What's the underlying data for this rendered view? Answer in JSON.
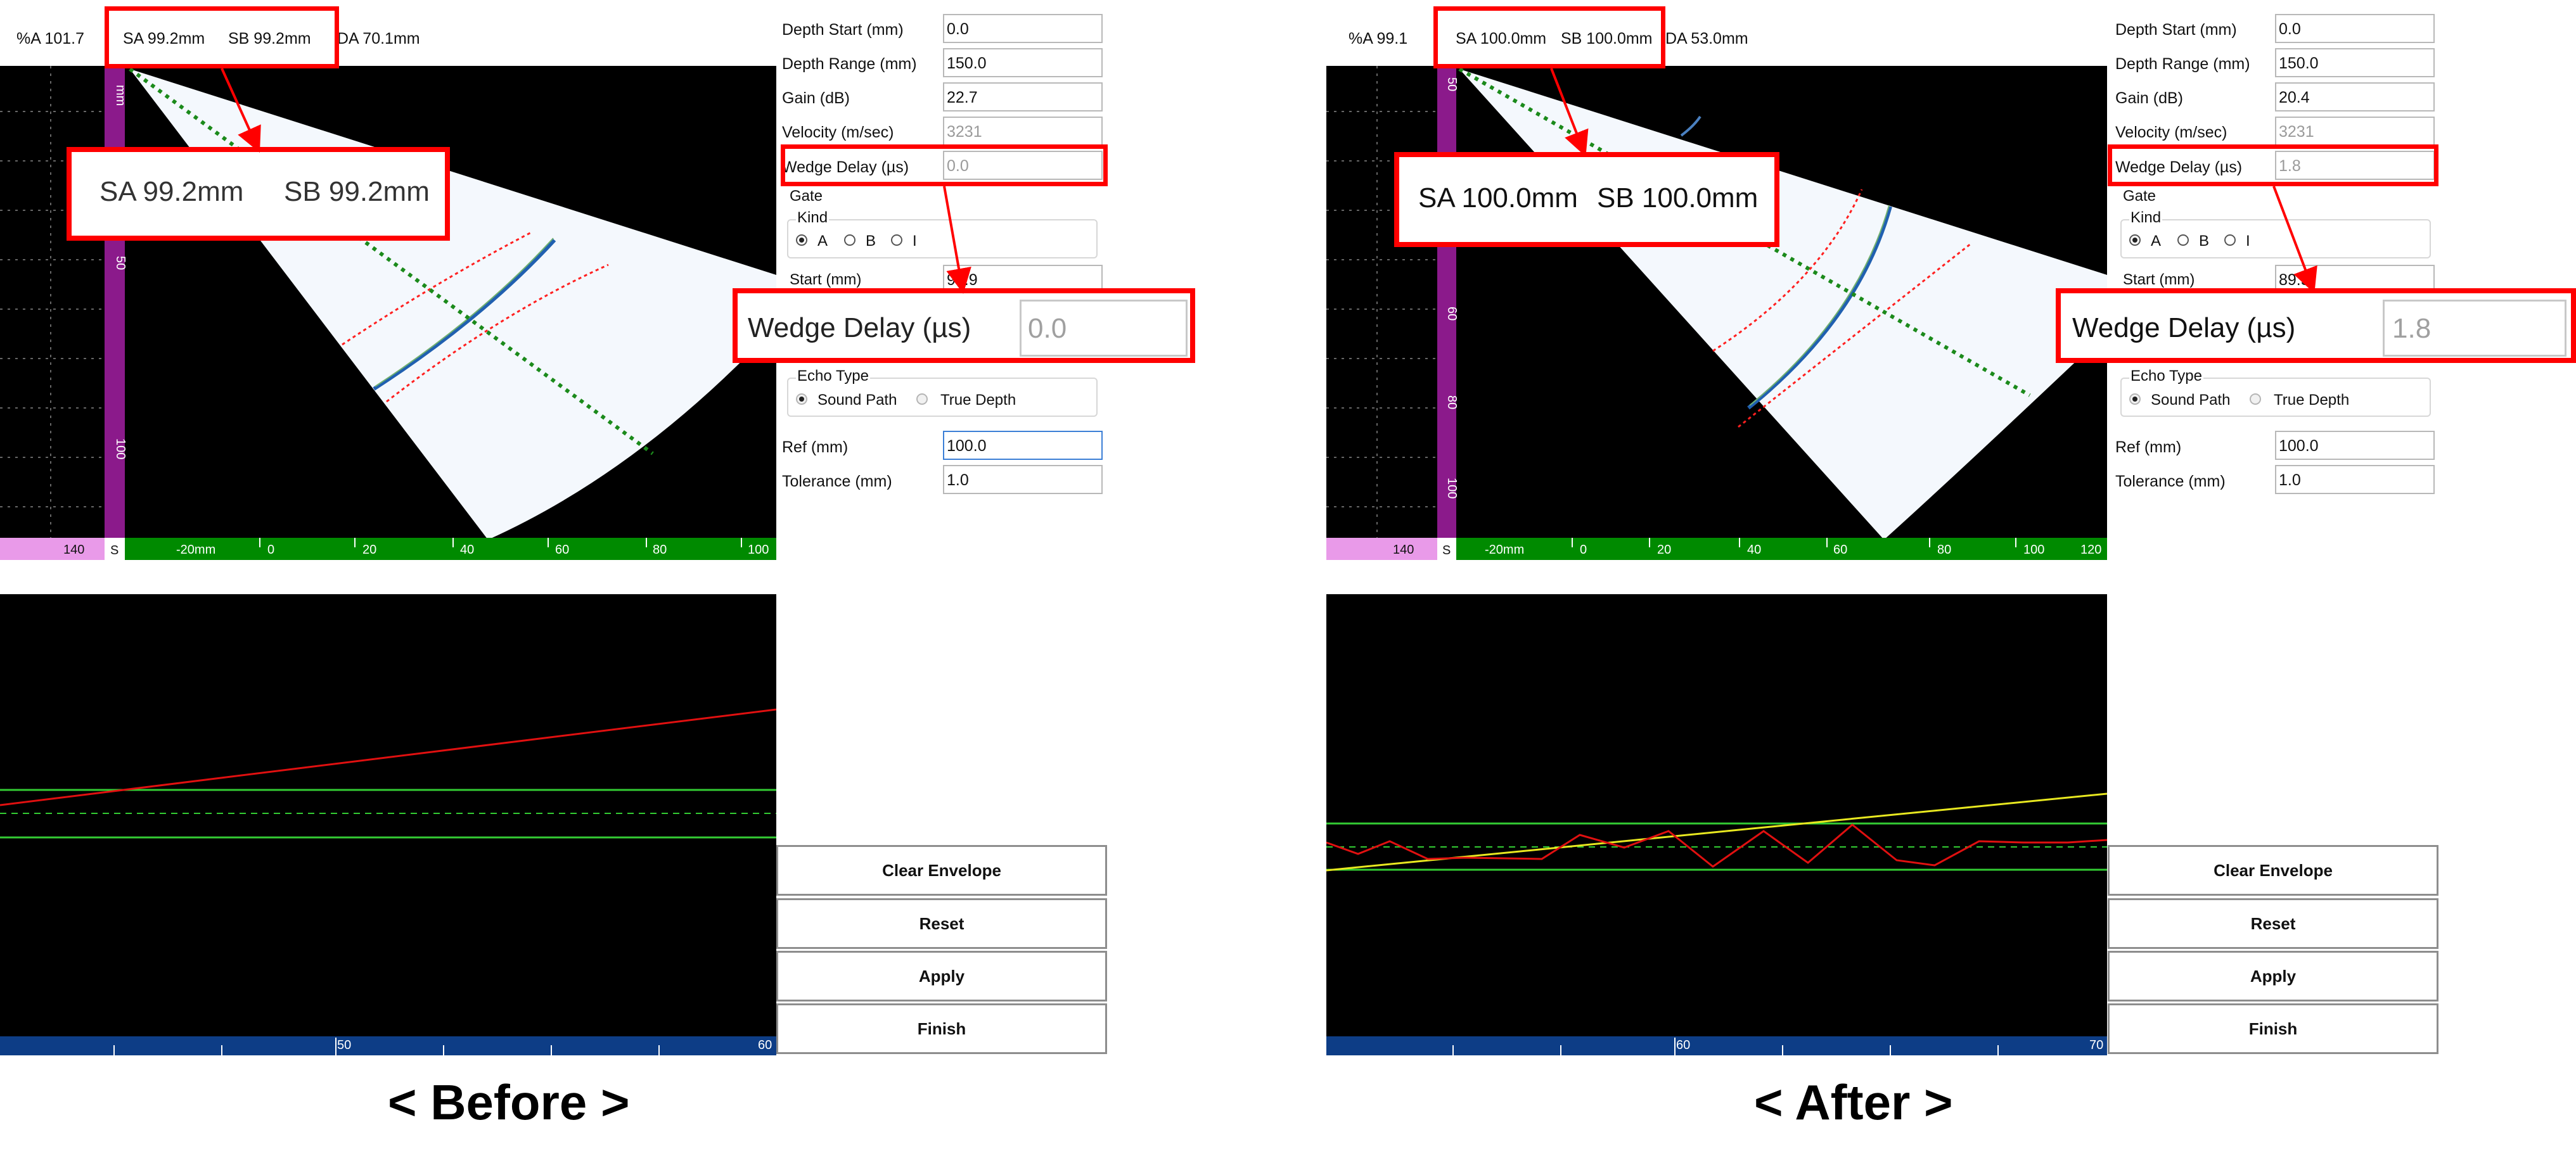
{
  "captions": {
    "before": "< Before >",
    "after": "< After >"
  },
  "before": {
    "top": {
      "pa": "%A 101.7",
      "sa": "SA 99.2mm",
      "sb": "SB 99.2mm",
      "da": "DA 70.1mm"
    },
    "zoom_sa": "SA 99.2mm",
    "zoom_sb": "SB 99.2mm",
    "zoom_wedge_label": "Wedge Delay (µs)",
    "zoom_wedge_value": "0.0",
    "params": {
      "depth_start_label": "Depth Start (mm)",
      "depth_start": "0.0",
      "depth_range_label": "Depth Range (mm)",
      "depth_range": "150.0",
      "gain_label": "Gain (dB)",
      "gain": "22.7",
      "velocity_label": "Velocity (m/sec)",
      "velocity": "3231",
      "wedge_label": "Wedge Delay (µs)",
      "wedge": "0.0",
      "gate_label": "Gate",
      "kind_label": "Kind",
      "kind_a": "A",
      "kind_b": "B",
      "kind_i": "I",
      "start_label": "Start (mm)",
      "start": "90.9",
      "echo_label": "Echo Type",
      "sound_path": "Sound Path",
      "true_depth": "True Depth",
      "ref_label": "Ref (mm)",
      "ref": "100.0",
      "tol_label": "Tolerance (mm)",
      "tol": "1.0"
    },
    "scan": {
      "vticks": [
        "mm",
        "50",
        "100"
      ],
      "hticks": [
        "140",
        "S",
        "-20mm",
        "0",
        "20",
        "40",
        "60",
        "80",
        "100"
      ]
    },
    "ascan": {
      "ticks": [
        "50",
        "60"
      ]
    },
    "buttons": {
      "clear": "Clear Envelope",
      "reset": "Reset",
      "apply": "Apply",
      "finish": "Finish"
    }
  },
  "after": {
    "top": {
      "pa": "%A 99.1",
      "sa": "SA 100.0mm",
      "sb": "SB 100.0mm",
      "da": "DA 53.0mm"
    },
    "zoom_sa": "SA 100.0mm",
    "zoom_sb": "SB 100.0mm",
    "zoom_wedge_label": "Wedge Delay (µs)",
    "zoom_wedge_value": "1.8",
    "params": {
      "depth_start_label": "Depth Start (mm)",
      "depth_start": "0.0",
      "depth_range_label": "Depth Range (mm)",
      "depth_range": "150.0",
      "gain_label": "Gain (dB)",
      "gain": "20.4",
      "velocity_label": "Velocity (m/sec)",
      "velocity": "3231",
      "wedge_label": "Wedge Delay (µs)",
      "wedge": "1.8",
      "gate_label": "Gate",
      "kind_label": "Kind",
      "kind_a": "A",
      "kind_b": "B",
      "kind_i": "I",
      "start_label": "Start (mm)",
      "start": "89.5",
      "echo_label": "Echo Type",
      "sound_path": "Sound Path",
      "true_depth": "True Depth",
      "ref_label": "Ref (mm)",
      "ref": "100.0",
      "tol_label": "Tolerance (mm)",
      "tol": "1.0"
    },
    "scan": {
      "vticks": [
        "50",
        "60",
        "80",
        "100"
      ],
      "hticks": [
        "140",
        "S",
        "-20mm",
        "0",
        "20",
        "40",
        "60",
        "80",
        "100",
        "120"
      ]
    },
    "ascan": {
      "ticks": [
        "60",
        "70"
      ]
    },
    "buttons": {
      "clear": "Clear Envelope",
      "reset": "Reset",
      "apply": "Apply",
      "finish": "Finish"
    }
  },
  "colors": {
    "highlight": "#ff0000",
    "gate_line": "#33cc33",
    "envelope_before": "#e01010",
    "envelope_after_yellow": "#e8e820",
    "ruler_green": "#008a00",
    "ruler_purple": "#8b1a8b",
    "ruler_blue": "#0d3d86"
  },
  "icons": {
    "arrow": "red-callout-arrow"
  }
}
